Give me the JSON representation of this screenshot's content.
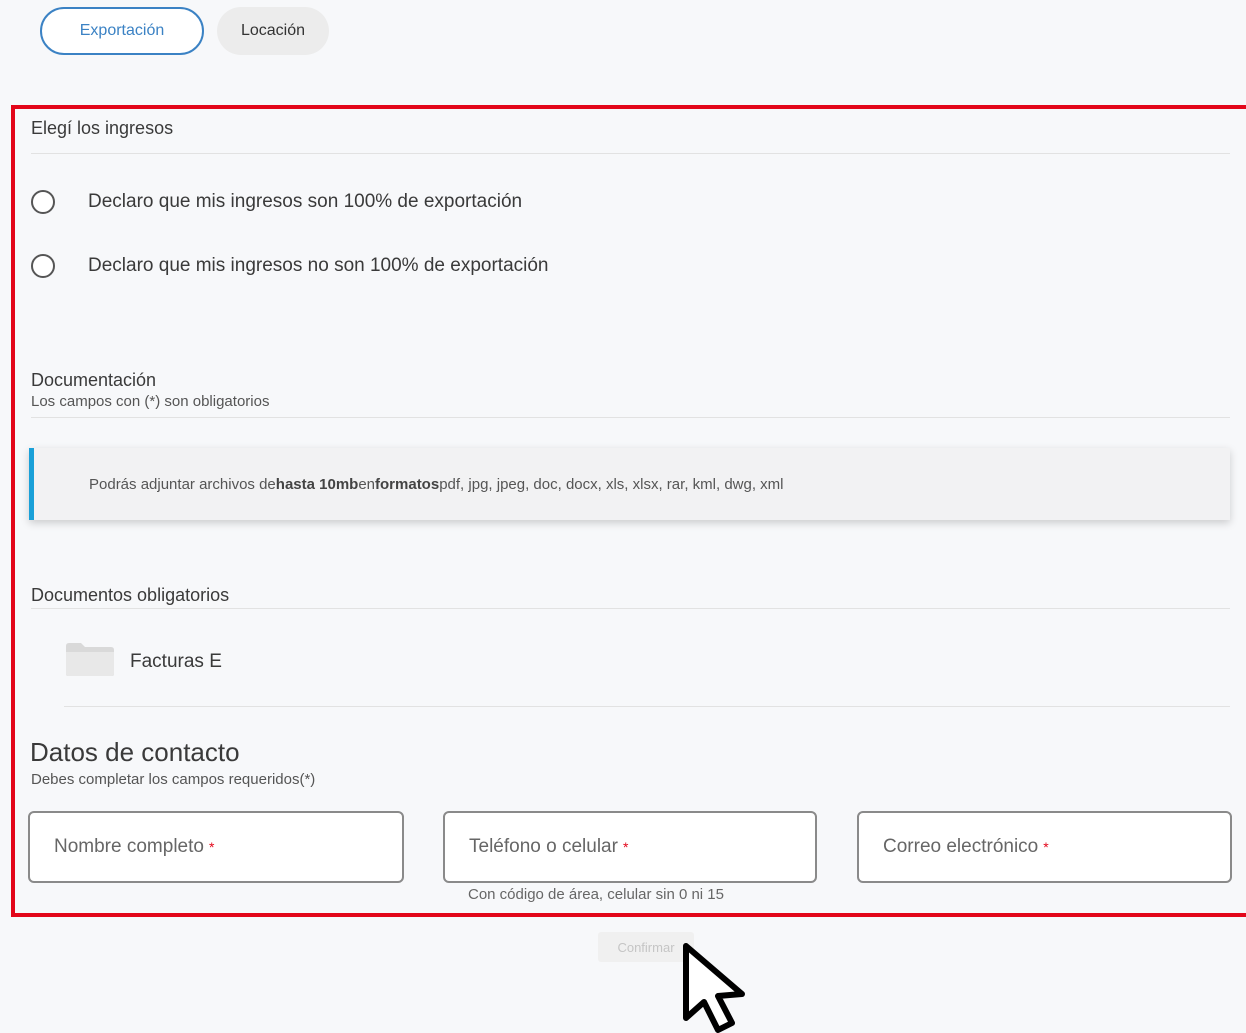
{
  "tabs": {
    "active": "Exportación",
    "inactive": "Locación"
  },
  "income": {
    "title": "Elegí los ingresos",
    "options": [
      "Declaro que mis ingresos son 100% de exportación",
      "Declaro que mis ingresos no son 100% de exportación"
    ]
  },
  "documentation": {
    "title": "Documentación",
    "subtitle": "Los campos con (*) son obligatorios",
    "info_prefix": "Podrás adjuntar archivos de ",
    "info_bold_1": "hasta 10mb",
    "info_middle": " en ",
    "info_bold_2": "formatos",
    "info_suffix": " pdf, jpg, jpeg, doc, docx, xls, xlsx, rar, kml, dwg, xml",
    "accent_color": "#1aa0d8"
  },
  "mandatory_docs": {
    "title": "Documentos obligatorios",
    "items": [
      "Facturas E"
    ]
  },
  "contact": {
    "title": "Datos de contacto",
    "subtitle": "Debes completar los campos requeridos(*)",
    "fields": {
      "name": "Nombre completo",
      "phone": "Teléfono o celular",
      "email": "Correo electrónico"
    },
    "required_mark": "*",
    "phone_helper": "Con código de área, celular sin 0 ni 15"
  },
  "confirm_label": "Confirmar",
  "colors": {
    "primary": "#3b82c4",
    "highlight": "#e3061a"
  }
}
